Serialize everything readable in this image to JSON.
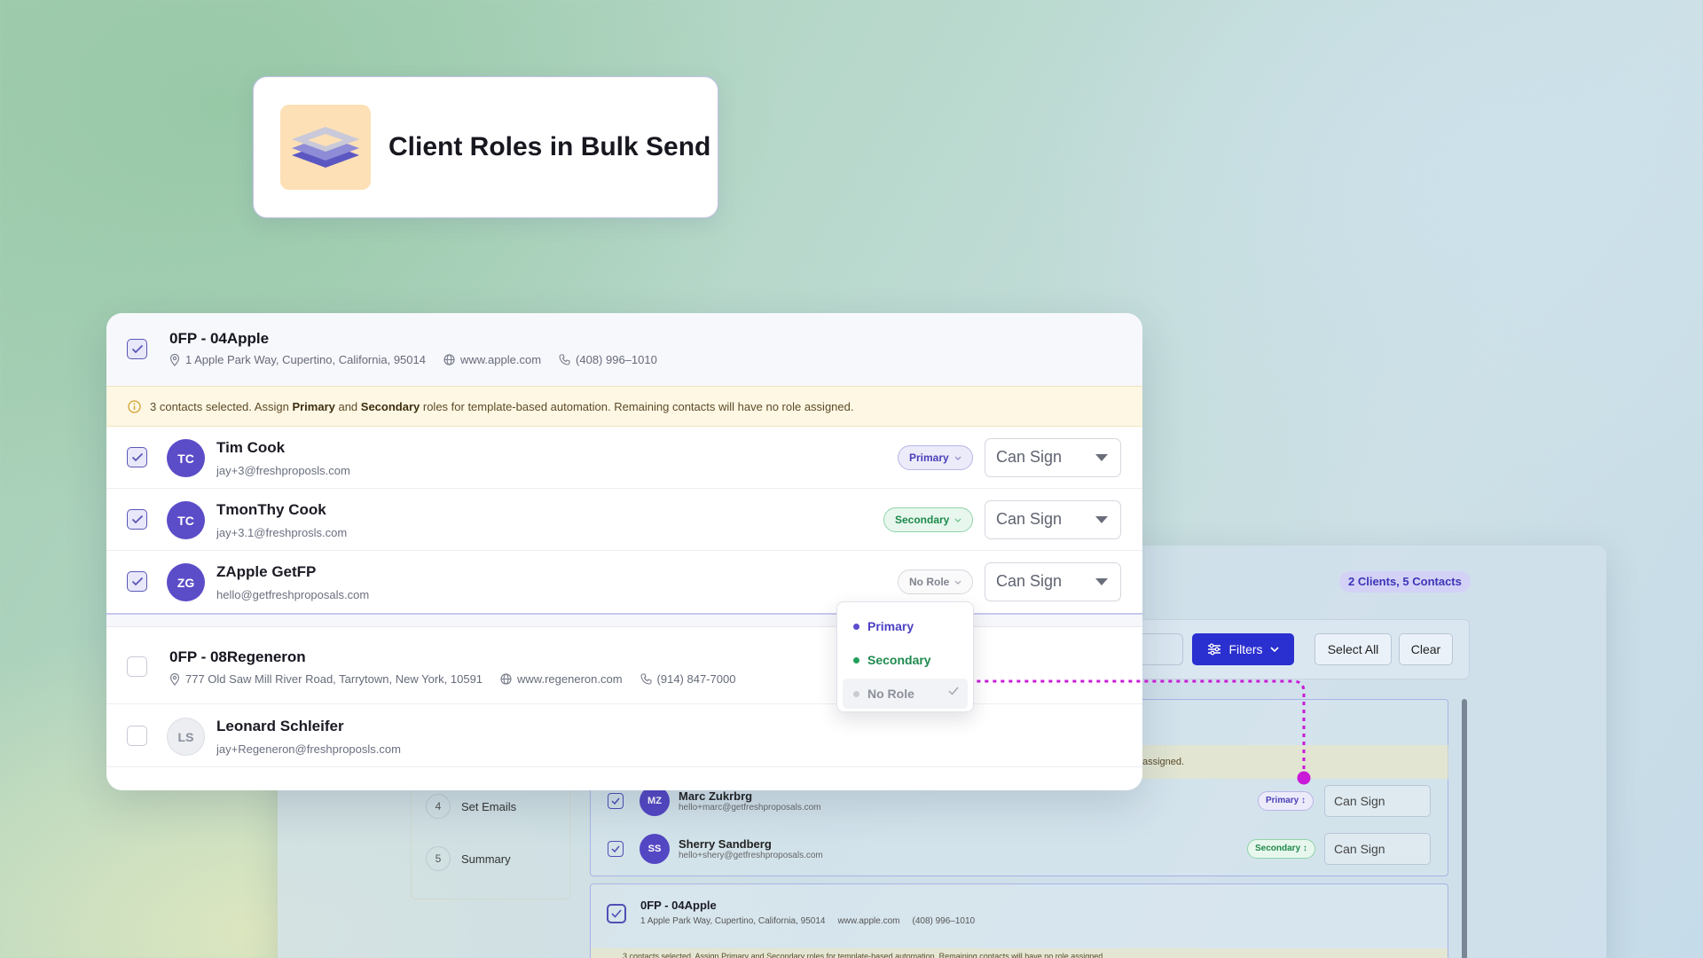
{
  "title_card": {
    "title": "Client Roles in Bulk Send",
    "icon": "layers-icon"
  },
  "background_app": {
    "count_badge": "2 Clients, 5 Contacts",
    "filters_label": "Filters",
    "select_all_label": "Select All",
    "clear_label": "Clear",
    "notice_fragment": "assigned.",
    "steps": [
      {
        "num": "4",
        "label": "Set Emails"
      },
      {
        "num": "5",
        "label": "Summary"
      }
    ],
    "contacts": [
      {
        "initials": "MZ",
        "name": "Marc Zukrbrg",
        "email": "hello+marc@getfreshproposals.com",
        "role": "Primary",
        "permission": "Can Sign"
      },
      {
        "initials": "SS",
        "name": "Sherry Sandberg",
        "email": "hello+shery@getfreshproposals.com",
        "role": "Secondary",
        "permission": "Can Sign"
      }
    ],
    "client2": {
      "name": "0FP - 04Apple",
      "address": "1 Apple Park Way, Cupertino, California, 95014",
      "website": "www.apple.com",
      "phone": "(408) 996–1010",
      "notice": "3 contacts selected. Assign Primary and Secondary roles for template-based automation. Remaining contacts will have no role assigned."
    }
  },
  "client1": {
    "name": "0FP - 04Apple",
    "address": "1 Apple Park Way, Cupertino, California, 95014",
    "website": "www.apple.com",
    "phone": "(408) 996–1010",
    "notice": {
      "prefix": "3 contacts selected. Assign ",
      "primary": "Primary",
      "and": " and ",
      "secondary": "Secondary",
      "suffix": " roles for template-based automation. Remaining contacts will have no role assigned."
    },
    "contacts": [
      {
        "initials": "TC",
        "name": "Tim Cook",
        "email": "jay+3@freshproposls.com",
        "role": "Primary",
        "permission": "Can Sign"
      },
      {
        "initials": "TC",
        "name": "TmonThy Cook",
        "email": "jay+3.1@freshprosls.com",
        "role": "Secondary",
        "permission": "Can Sign"
      },
      {
        "initials": "ZG",
        "name": "ZApple GetFP",
        "email": "hello@getfreshproposals.com",
        "role": "No Role",
        "permission": "Can Sign"
      }
    ]
  },
  "role_dropdown": {
    "options": [
      {
        "label": "Primary",
        "color": "#5b4cd0"
      },
      {
        "label": "Secondary",
        "color": "#22a05a"
      },
      {
        "label": "No Role",
        "color": "#c9ccd3",
        "selected": true
      }
    ]
  },
  "client2": {
    "name": "0FP - 08Regeneron",
    "address": "777 Old Saw Mill River Road, Tarrytown, New York, 10591",
    "website": "www.regeneron.com",
    "phone": "(914) 847-7000",
    "contacts": [
      {
        "initials": "LS",
        "name": "Leonard Schleifer",
        "email": "jay+Regeneron@freshproposls.com"
      }
    ]
  },
  "colors": {
    "accent": "#5b4cc8",
    "annotation": "#c81ad8",
    "filters_button": "#2a2fcf"
  }
}
